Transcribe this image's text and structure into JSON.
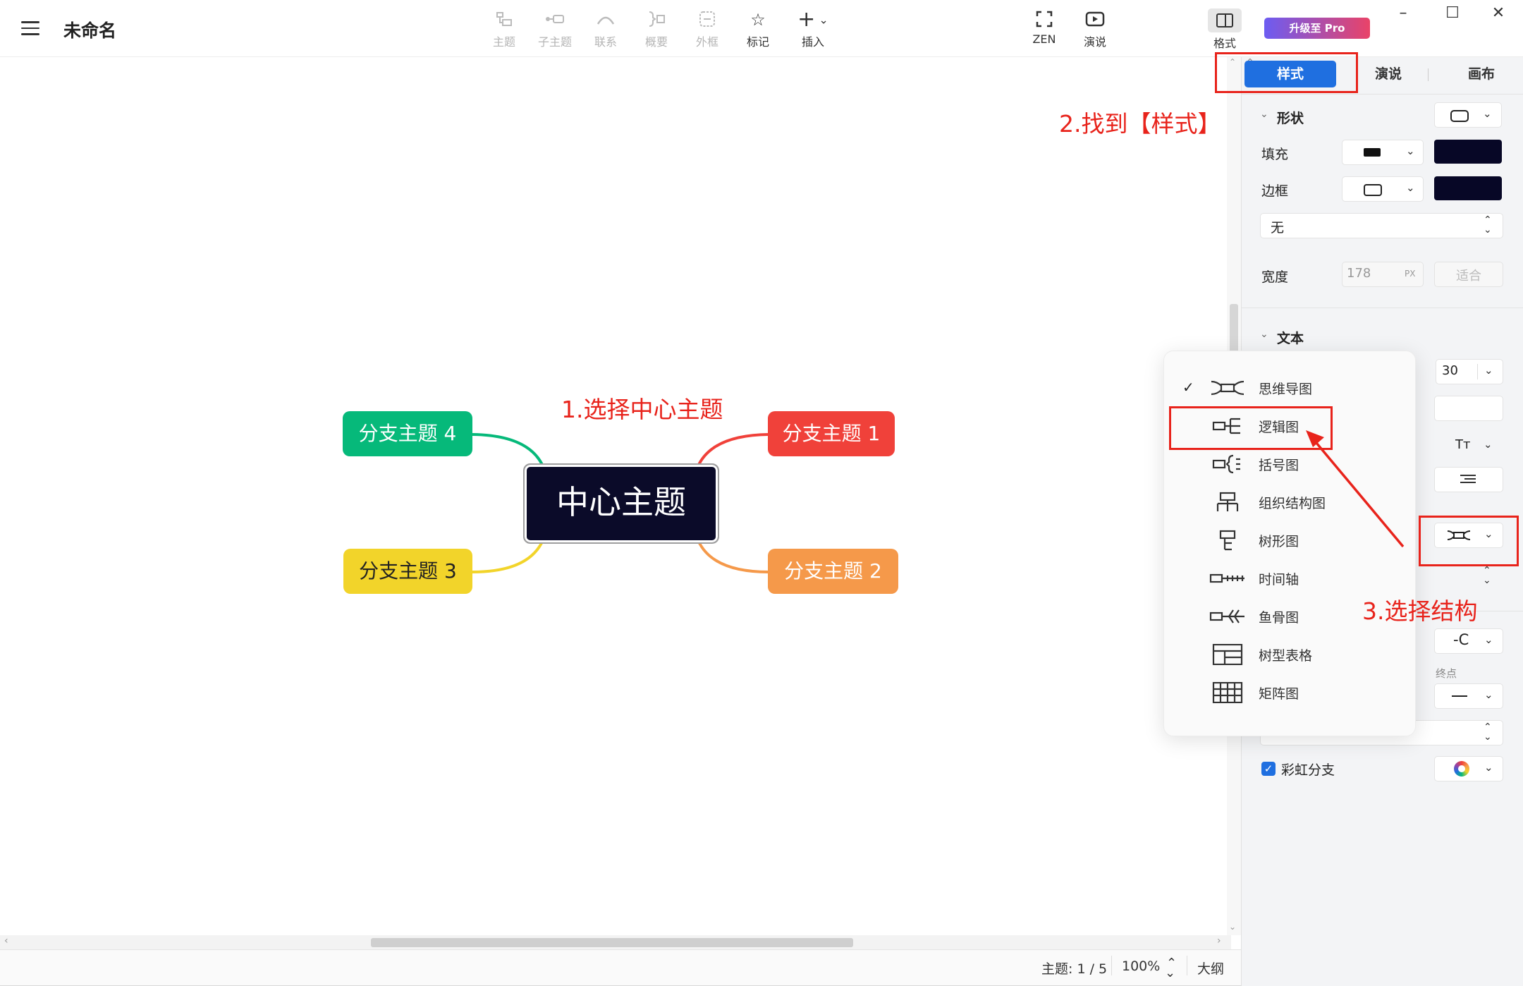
{
  "app": {
    "title": "未命名"
  },
  "toolbar": {
    "items": [
      {
        "label": "主题",
        "enabled": false
      },
      {
        "label": "子主题",
        "enabled": false
      },
      {
        "label": "联系",
        "enabled": false
      },
      {
        "label": "概要",
        "enabled": false
      },
      {
        "label": "外框",
        "enabled": false
      },
      {
        "label": "标记",
        "enabled": true
      },
      {
        "label": "插入",
        "enabled": true
      }
    ],
    "zen_label": "ZEN",
    "present_label": "演说",
    "format_label": "格式",
    "upgrade_label": "升级至 Pro"
  },
  "mindmap": {
    "center": "中心主题",
    "branches": [
      {
        "label": "分支主题 1",
        "color": "#f0413a"
      },
      {
        "label": "分支主题 2",
        "color": "#f5994a"
      },
      {
        "label": "分支主题 3",
        "color": "#f2d42a"
      },
      {
        "label": "分支主题 4",
        "color": "#06b97a"
      }
    ]
  },
  "annotations": {
    "step1": "1.选择中心主题",
    "step2": "2.找到【样式】",
    "step3": "3.选择结构"
  },
  "panel": {
    "tabs": [
      "样式",
      "演说",
      "画布"
    ],
    "active_tab": "样式",
    "shape_section": "形状",
    "fill_label": "填充",
    "border_label": "边框",
    "border_style_value": "无",
    "width_label": "宽度",
    "width_value": "178",
    "width_unit": "PX",
    "fit_label": "适合",
    "text_section": "文本",
    "font_size_value": "30",
    "text_case_label": "Tт",
    "end_label": "终点",
    "rainbow_label": "彩虹分支",
    "rainbow_checked": true,
    "fill_color": "#070726"
  },
  "structure_menu": {
    "items": [
      {
        "label": "思维导图",
        "checked": true,
        "icon": "mind-map-icon"
      },
      {
        "label": "逻辑图",
        "checked": false,
        "icon": "logic-chart-icon"
      },
      {
        "label": "括号图",
        "checked": false,
        "icon": "brace-map-icon"
      },
      {
        "label": "组织结构图",
        "checked": false,
        "icon": "org-chart-icon"
      },
      {
        "label": "树形图",
        "checked": false,
        "icon": "tree-chart-icon"
      },
      {
        "label": "时间轴",
        "checked": false,
        "icon": "timeline-icon"
      },
      {
        "label": "鱼骨图",
        "checked": false,
        "icon": "fishbone-icon"
      },
      {
        "label": "树型表格",
        "checked": false,
        "icon": "tree-table-icon"
      },
      {
        "label": "矩阵图",
        "checked": false,
        "icon": "matrix-icon"
      }
    ]
  },
  "status": {
    "topic_count": "主题: 1 / 5",
    "zoom": "100%",
    "outline_label": "大纲"
  },
  "colors": {
    "accent": "#1f6fe0",
    "annotation": "#e8231b"
  }
}
